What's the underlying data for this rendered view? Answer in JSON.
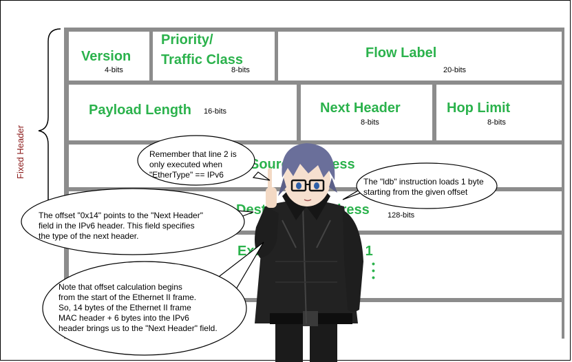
{
  "side_label": "Fixed Header",
  "fields": {
    "version": {
      "name": "Version",
      "bits": "4-bits"
    },
    "priority": {
      "name_line1": "Priority/",
      "name_line2": "Traffic Class",
      "bits": "8-bits"
    },
    "flow_label": {
      "name": "Flow Label",
      "bits": "20-bits"
    },
    "payload_length": {
      "name": "Payload Length",
      "bits": "16-bits"
    },
    "next_header": {
      "name": "Next Header",
      "bits": "8-bits"
    },
    "hop_limit": {
      "name": "Hop Limit",
      "bits": "8-bits"
    },
    "source_address": {
      "name": "Source Address"
    },
    "destination_address": {
      "name": "Destination Address",
      "bits": "128-bits"
    },
    "extension_headers": {
      "name": "Extension Headers 1"
    }
  },
  "callouts": {
    "line2": {
      "lines": [
        "Remember that line 2 is",
        "only executed when",
        "\"EtherType\" == IPv6"
      ]
    },
    "ldb": {
      "lines": [
        "The \"ldb\" instruction loads 1 byte",
        "starting from the given offset"
      ]
    },
    "offset": {
      "lines": [
        "The offset \"0x14\" points to the \"Next Header\"",
        "field in the IPv6 header. This field specifies",
        "the type of the next header."
      ]
    },
    "calc": {
      "lines": [
        "Note that offset calculation begins",
        "from the start of the Ethernet II frame.",
        "So, 14 bytes of the Ethernet II frame",
        "MAC header + 6 bytes into the IPv6",
        "header brings us to the \"Next Header\" field."
      ]
    }
  },
  "colors": {
    "field_green": "#2bb24c",
    "grid_gray": "#8c8c8c",
    "side_label": "#8b1a1a"
  }
}
